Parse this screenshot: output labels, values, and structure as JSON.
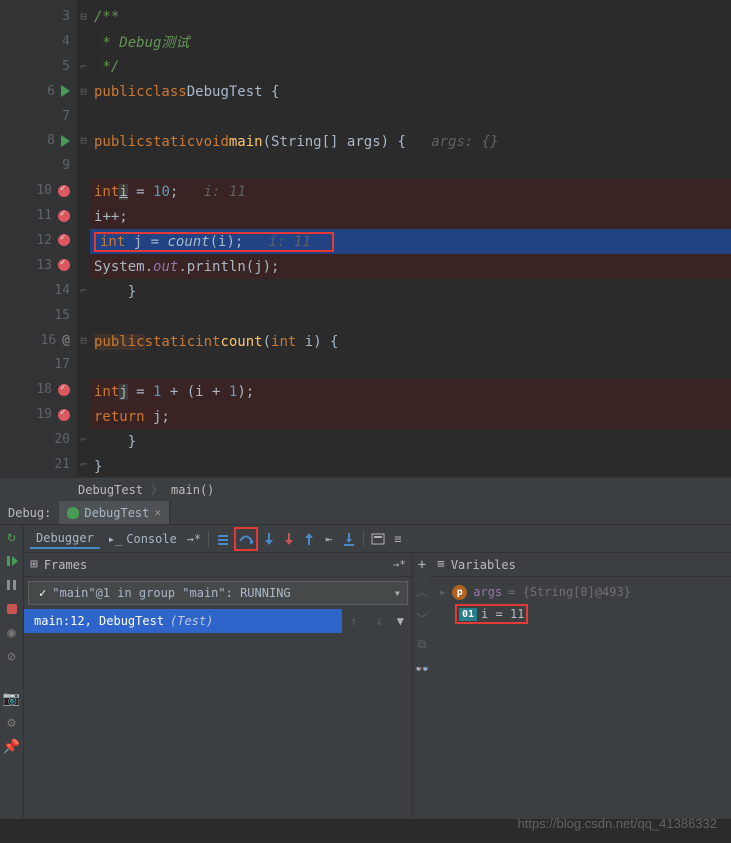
{
  "code": {
    "lines": [
      {
        "n": 3,
        "text": "/**",
        "cls": "c-comment"
      },
      {
        "n": 4,
        "text": " * Debug测试",
        "cls": "c-comment"
      },
      {
        "n": 5,
        "text": " */",
        "cls": "c-comment"
      },
      {
        "n": 6
      },
      {
        "n": 7
      },
      {
        "n": 8
      },
      {
        "n": 9
      },
      {
        "n": 10
      },
      {
        "n": 11
      },
      {
        "n": 12
      },
      {
        "n": 13
      },
      {
        "n": 14
      },
      {
        "n": 15
      },
      {
        "n": 16
      },
      {
        "n": 17
      },
      {
        "n": 18
      },
      {
        "n": 19
      },
      {
        "n": 20
      },
      {
        "n": 21
      }
    ],
    "tokens": {
      "kw_public": "public",
      "kw_class": "class",
      "kw_static": "static",
      "kw_void": "void",
      "kw_int": "int",
      "kw_return": "return",
      "cls_name": "DebugTest",
      "fn_main": "main",
      "fn_count": "count",
      "type_string": "String",
      "var_args": "args",
      "var_i": "i",
      "var_j": "j",
      "n10": "10",
      "n1": "1",
      "n11": "11",
      "sys": "System",
      "out": "out",
      "println": "println",
      "hint_args": "args: {}",
      "hint_i10": "i: 11",
      "hint_i12": "i: 11"
    }
  },
  "breadcrumb": {
    "cls": "DebugTest",
    "sep": "〉",
    "method": "main()"
  },
  "debug": {
    "label": "Debug:",
    "tab": "DebugTest",
    "sub_debugger": "Debugger",
    "sub_console": "Console",
    "frames_title": "Frames",
    "vars_title": "Variables",
    "thread_dropdown": "\"main\"@1 in group \"main\": RUNNING",
    "frame1_a": "main:12, DebugTest",
    "frame1_b": "(Test)",
    "var_args_name": "args",
    "var_args_val": "= {String[0]@493}",
    "var_i_text": "i = 11"
  },
  "watermark": "https://blog.csdn.net/qq_41386332"
}
